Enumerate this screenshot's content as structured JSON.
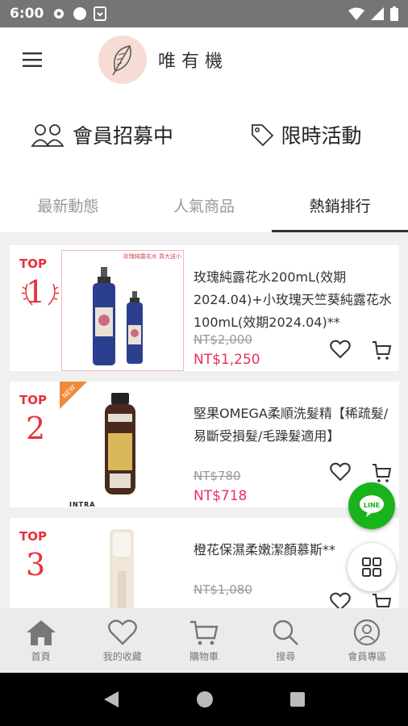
{
  "status": {
    "time": "6:00"
  },
  "header": {
    "brand": "唯有機"
  },
  "promo": {
    "recruit_label": "會員招募中",
    "sale_label": "限時活動"
  },
  "tabs": [
    {
      "label": "最新動態",
      "active": false
    },
    {
      "label": "人氣商品",
      "active": false
    },
    {
      "label": "熱銷排行",
      "active": true
    }
  ],
  "products": [
    {
      "rank_label": "TOP",
      "rank": "1",
      "thumb_caption": "玫瑰純露花水 買大送小",
      "name": "玫瑰純露花水200mL(效期2024.04)+小玫瑰天竺葵純露花水100mL(效期2024.04)**",
      "old_price": "NT$2,000",
      "price": "NT$1,250"
    },
    {
      "rank_label": "TOP",
      "rank": "2",
      "badge": "NEW",
      "brand_mark": "INTRA",
      "name": "堅果OMEGA柔順洗髮精【稀疏髮/易斷受損髮/毛躁髮適用】",
      "old_price": "NT$780",
      "price": "NT$718"
    },
    {
      "rank_label": "TOP",
      "rank": "3",
      "name": "橙花保濕柔嫩潔顏慕斯**",
      "old_price": "NT$1,080",
      "price": ""
    }
  ],
  "fab": {
    "line_label": "LINE"
  },
  "bottom_nav": [
    {
      "label": "首頁",
      "icon": "home-icon"
    },
    {
      "label": "我的收藏",
      "icon": "heart-icon"
    },
    {
      "label": "購物車",
      "icon": "cart-icon"
    },
    {
      "label": "搜尋",
      "icon": "search-icon"
    },
    {
      "label": "會員專區",
      "icon": "user-icon"
    }
  ],
  "colors": {
    "accent_red": "#e8303a",
    "price_pink": "#e8305e",
    "line_green": "#19b31c"
  }
}
